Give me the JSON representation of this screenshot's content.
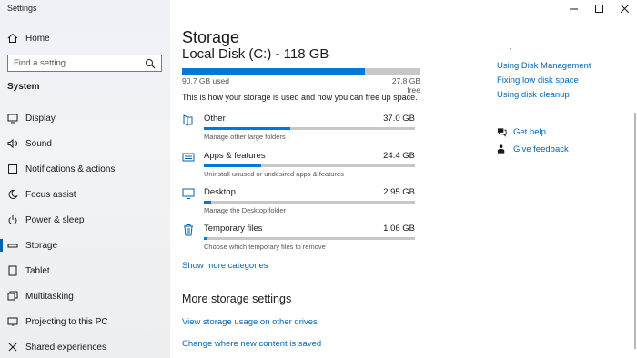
{
  "app": {
    "title": "Settings"
  },
  "sidebar": {
    "home_label": "Home",
    "search_placeholder": "Find a setting",
    "section_label": "System",
    "items": [
      {
        "label": "Display",
        "icon": "display-icon"
      },
      {
        "label": "Sound",
        "icon": "sound-icon"
      },
      {
        "label": "Notifications & actions",
        "icon": "notifications-icon"
      },
      {
        "label": "Focus assist",
        "icon": "focus-assist-icon"
      },
      {
        "label": "Power & sleep",
        "icon": "power-icon"
      },
      {
        "label": "Storage",
        "icon": "storage-icon",
        "active": true
      },
      {
        "label": "Tablet",
        "icon": "tablet-icon"
      },
      {
        "label": "Multitasking",
        "icon": "multitasking-icon"
      },
      {
        "label": "Projecting to this PC",
        "icon": "projecting-icon"
      },
      {
        "label": "Shared experiences",
        "icon": "shared-experiences-icon"
      }
    ]
  },
  "main": {
    "title": "Storage",
    "disk_label": "Local Disk (C:) - 118 GB",
    "used_label": "90.7 GB used",
    "free_label": "27.8 GB free",
    "used_fraction": 0.768,
    "description": "This is how your storage is used and how you can free up space.",
    "categories": [
      {
        "name": "Other",
        "size": "37.0 GB",
        "sub": "Manage other large folders",
        "fraction": 0.41,
        "icon": "other-icon"
      },
      {
        "name": "Apps & features",
        "size": "24.4 GB",
        "sub": "Uninstall unused or undesired apps & features",
        "fraction": 0.27,
        "icon": "apps-icon"
      },
      {
        "name": "Desktop",
        "size": "2.95 GB",
        "sub": "Manage the Desktop folder",
        "fraction": 0.033,
        "icon": "desktop-icon"
      },
      {
        "name": "Temporary files",
        "size": "1.06 GB",
        "sub": "Choose which temporary files to remove",
        "fraction": 0.012,
        "icon": "trash-icon"
      }
    ],
    "show_more": "Show more categories",
    "more_settings_title": "More storage settings",
    "more_links": [
      "View storage usage on other drives",
      "Change where new content is saved"
    ]
  },
  "right": {
    "dot": "·",
    "links": [
      "Using Disk Management",
      "Fixing low disk space",
      "Using disk cleanup"
    ],
    "help": "Get help",
    "feedback": "Give feedback"
  },
  "colors": {
    "accent": "#0078d7",
    "link": "#0066b4",
    "bar_bg": "#c8c8c8"
  }
}
